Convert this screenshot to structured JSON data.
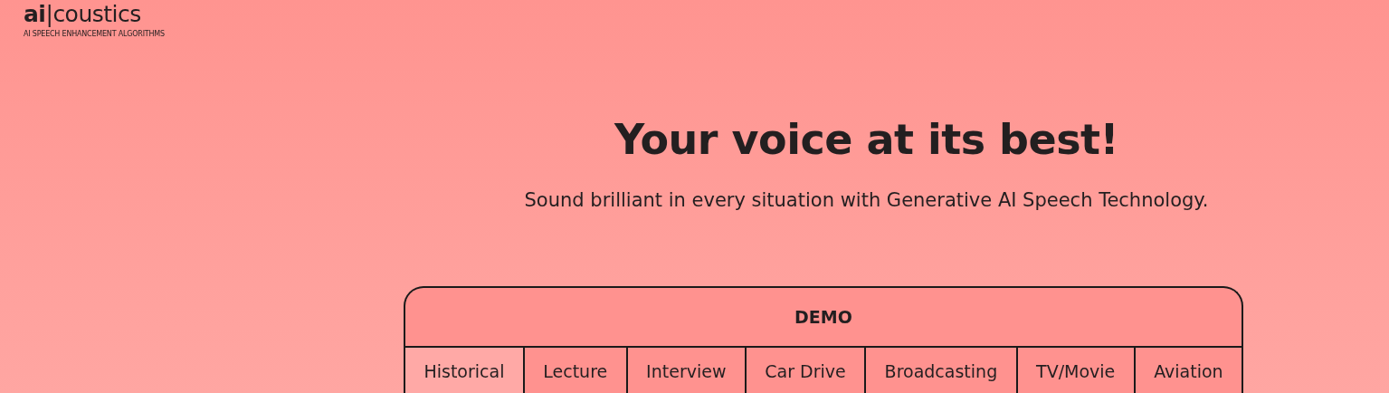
{
  "logo": {
    "wordmark": "**ai**|coustics",
    "tagline": "AI SPEECH ENHANCEMENT ALGORITHMS"
  },
  "hero": {
    "title": "Your voice at its best!",
    "subtitle": "Sound brilliant in every situation with Generative AI Speech Technology."
  },
  "demo": {
    "title": "DEMO",
    "tabs": [
      {
        "label": "Historical",
        "selected": true
      },
      {
        "label": "Lecture",
        "selected": false
      },
      {
        "label": "Interview",
        "selected": false
      },
      {
        "label": "Car Drive",
        "selected": false
      },
      {
        "label": "Broadcasting",
        "selected": false
      },
      {
        "label": "TV/Movie",
        "selected": false
      },
      {
        "label": "Aviation",
        "selected": false
      }
    ]
  }
}
